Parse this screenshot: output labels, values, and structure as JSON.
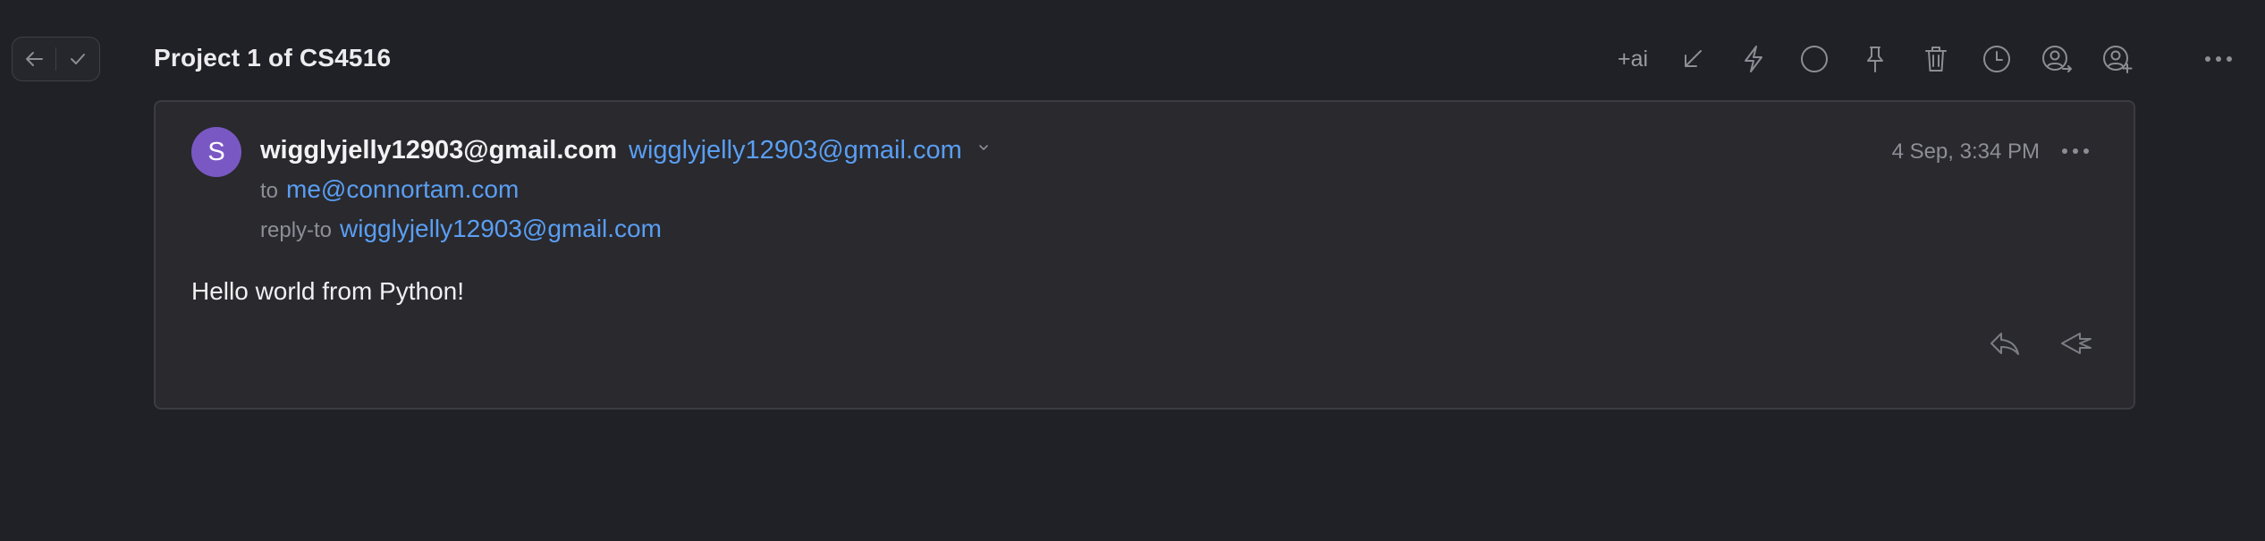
{
  "thread": {
    "title": "Project 1 of CS4516"
  },
  "nav": {
    "back_icon": "arrow-left-icon",
    "done_icon": "check-icon"
  },
  "toolbar": {
    "ai_label": "+ai",
    "icons": [
      "move-to-inbox-icon",
      "lightning-icon",
      "circle-icon",
      "pin-icon",
      "trash-icon",
      "clock-icon",
      "assign-user-icon",
      "add-user-icon",
      "more-horizontal-icon"
    ]
  },
  "message": {
    "avatar_initial": "S",
    "sender_name": "wigglyjelly12903@gmail.com",
    "sender_address": "wigglyjelly12903@gmail.com",
    "to_label": "to",
    "to_address": "me@connortam.com",
    "reply_to_label": "reply-to",
    "reply_to_address": "wigglyjelly12903@gmail.com",
    "timestamp": "4 Sep, 3:34 PM",
    "body": "Hello world from Python!"
  },
  "colors": {
    "background": "#202126",
    "card": "#29292e",
    "link": "#5a9ef2",
    "avatar": "#7a58c4",
    "muted": "#8d8e96"
  }
}
